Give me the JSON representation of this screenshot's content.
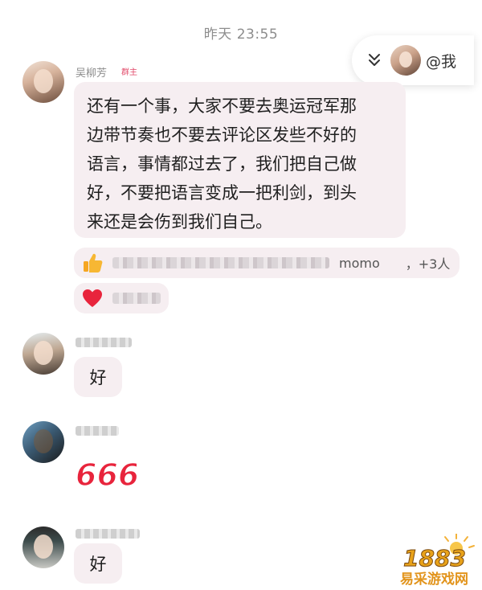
{
  "header": {
    "timestamp": "昨天 23:55"
  },
  "mention_pill": {
    "label": "@我",
    "chevron_icon": "double-chevron-down-icon"
  },
  "messages": [
    {
      "sender": "吴柳芳",
      "badge": "群主",
      "text_lines": [
        "还有一个事，大家不要去奥运冠军那",
        "边带节奏也不要去评论区发些不好的",
        "语言，事情都过去了，我们把自己做",
        "好，不要把语言变成一把利剑，到头",
        "来还是会伤到我们自己。"
      ],
      "reactions": [
        {
          "icon": "thumbs-up-icon",
          "names_visible": "momo",
          "count": "，+3人"
        },
        {
          "icon": "heart-icon"
        }
      ]
    },
    {
      "text": "好"
    },
    {
      "sticker": "666",
      "sticker_icon": "666-sticker-icon"
    },
    {
      "text": "好"
    }
  ],
  "watermark": {
    "logo_text": "1883",
    "text": "易采游戏网"
  },
  "colors": {
    "bubble": "#f6eef1",
    "badge": "#e24a6a",
    "sticker_red": "#e8243c",
    "watermark": "#e2941c"
  }
}
